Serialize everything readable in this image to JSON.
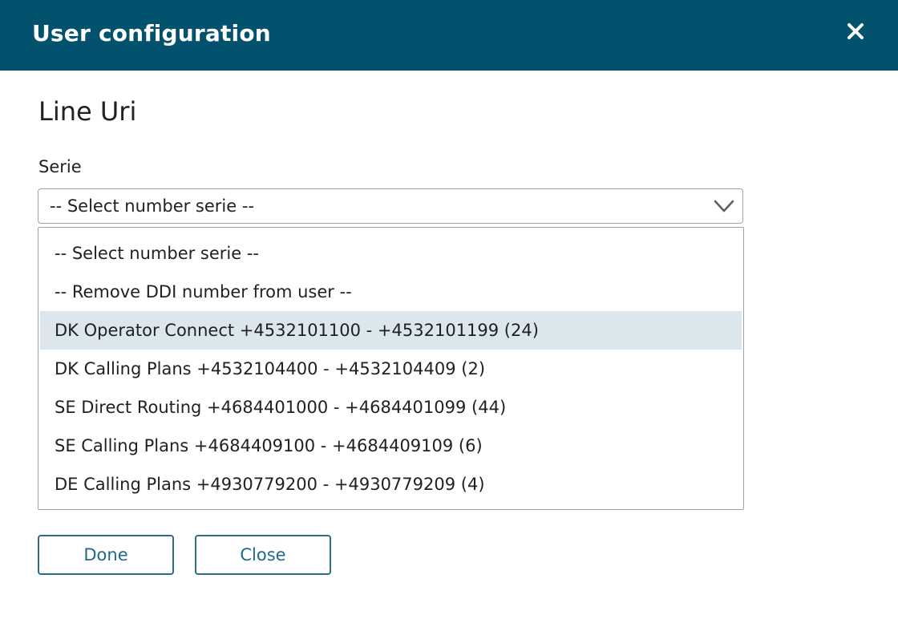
{
  "header": {
    "title": "User configuration",
    "close_icon": "close-icon"
  },
  "section": {
    "title": "Line Uri"
  },
  "serie_field": {
    "label": "Serie",
    "selected_value": "-- Select number serie --",
    "chevron_icon": "chevron-down-icon",
    "options": [
      {
        "label": "-- Select number serie --",
        "highlighted": false
      },
      {
        "label": "-- Remove DDI number from user --",
        "highlighted": false
      },
      {
        "label": "DK Operator Connect +4532101100 - +4532101199 (24)",
        "highlighted": true
      },
      {
        "label": "DK Calling Plans +4532104400 - +4532104409 (2)",
        "highlighted": false
      },
      {
        "label": "SE Direct Routing +4684401000 - +4684401099 (44)",
        "highlighted": false
      },
      {
        "label": "SE Calling Plans +4684409100 - +4684409109 (6)",
        "highlighted": false
      },
      {
        "label": "DE Calling Plans +4930779200 - +4930779209 (4)",
        "highlighted": false
      }
    ]
  },
  "buttons": {
    "done_label": "Done",
    "close_label": "Close"
  },
  "colors": {
    "header_bg": "#02526d",
    "accent": "#1d6a8c",
    "highlight_bg": "#dbe6ed"
  }
}
